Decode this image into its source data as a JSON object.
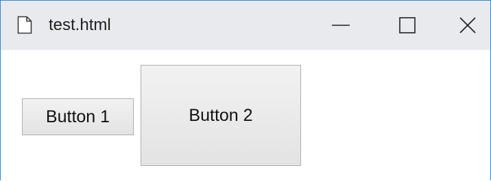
{
  "window": {
    "title": "test.html",
    "controls": {
      "minimize": "minimize-icon",
      "maximize": "maximize-icon",
      "close": "close-icon"
    },
    "accent_color": "#2b88d8",
    "titlebar_color": "#e8eaed"
  },
  "content": {
    "buttons": [
      {
        "label": "Button 1"
      },
      {
        "label": "Button 2"
      }
    ]
  }
}
